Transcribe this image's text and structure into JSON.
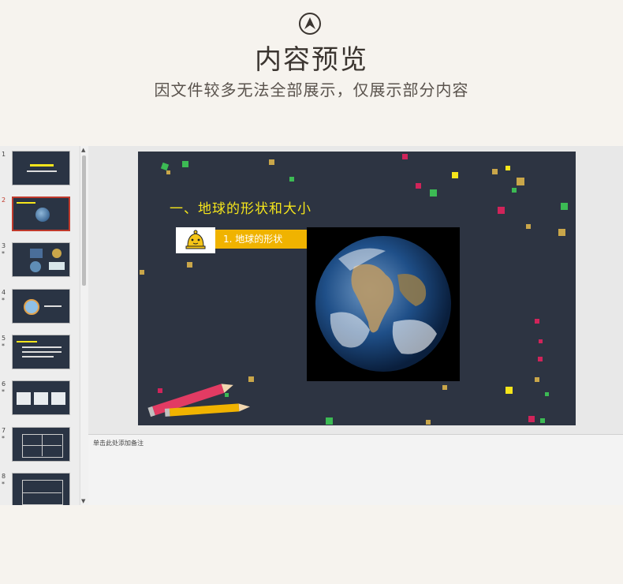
{
  "header": {
    "title": "内容预览",
    "subtitle": "因文件较多无法全部展示，仅展示部分内容"
  },
  "thumbnails": [
    {
      "num": "1",
      "star": ""
    },
    {
      "num": "2",
      "star": ""
    },
    {
      "num": "3",
      "star": "*"
    },
    {
      "num": "4",
      "star": "*"
    },
    {
      "num": "5",
      "star": "*"
    },
    {
      "num": "6",
      "star": "*"
    },
    {
      "num": "7",
      "star": "*"
    },
    {
      "num": "8",
      "star": "*"
    }
  ],
  "slide": {
    "heading": "一、地球的形状和大小",
    "badge_label": "1. 地球的形状"
  },
  "notes": {
    "placeholder": "单击此处添加备注"
  },
  "colors": {
    "slide_bg": "#2d3442",
    "heading": "#f5e51b",
    "badge": "#f0b300",
    "active_border": "#c0392b"
  }
}
